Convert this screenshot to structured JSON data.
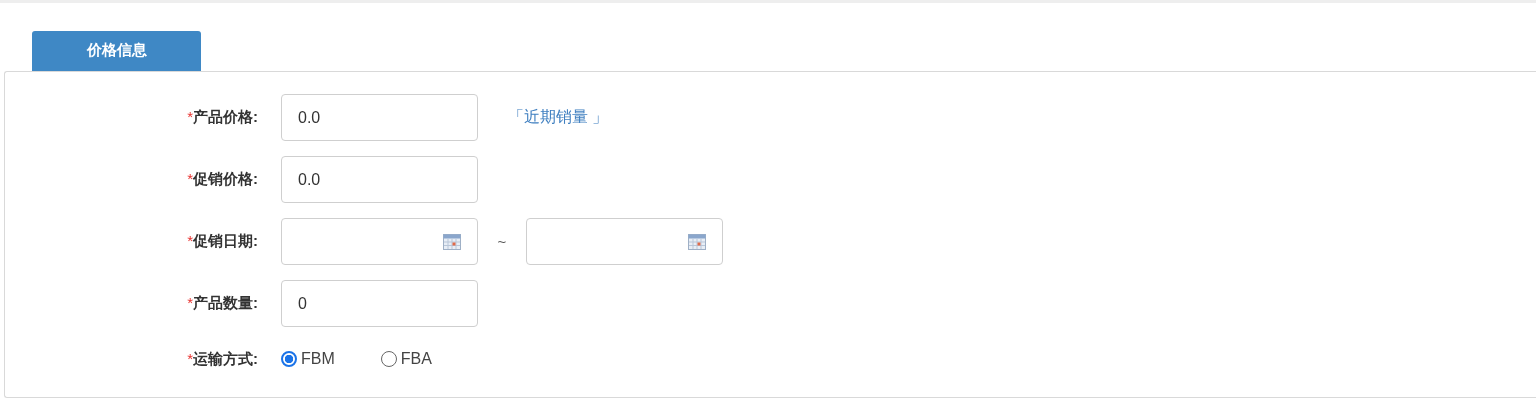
{
  "tabs": [
    {
      "label": "价格信息",
      "selected": true
    }
  ],
  "fields": [
    {
      "kind": "text",
      "marker": "*",
      "label": "产品价格:",
      "value": "0.0",
      "link": "「近期销量 」"
    },
    {
      "kind": "text",
      "marker": "*",
      "label": "促销价格:",
      "value": "0.0"
    },
    {
      "kind": "date_range",
      "marker": "*",
      "label": "促销日期:",
      "separator": "~"
    },
    {
      "kind": "text",
      "marker": "*",
      "label": "产品数量:",
      "value": "0"
    },
    {
      "kind": "radio",
      "marker": "*",
      "label": "运输方式:",
      "options": [
        {
          "label": "FBM",
          "selected": true
        },
        {
          "label": "FBA",
          "selected": false
        }
      ]
    }
  ]
}
